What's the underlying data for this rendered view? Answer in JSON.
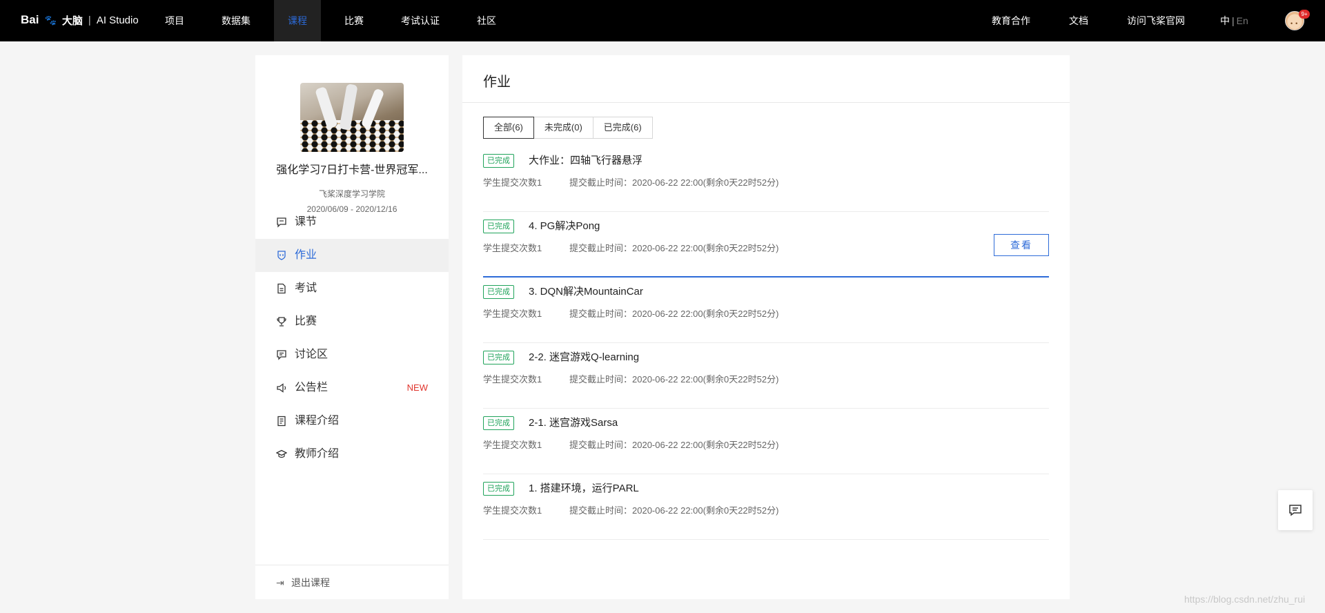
{
  "header": {
    "logo_text": "Bai",
    "logo_cn": "大脑",
    "logo_sep": "|",
    "logo_product": "AI Studio",
    "nav": [
      {
        "label": "项目"
      },
      {
        "label": "数据集"
      },
      {
        "label": "课程",
        "active": true
      },
      {
        "label": "比赛"
      },
      {
        "label": "考试认证"
      },
      {
        "label": "社区"
      }
    ],
    "right_links": [
      {
        "label": "教育合作"
      },
      {
        "label": "文档"
      },
      {
        "label": "访问飞桨官网"
      }
    ],
    "lang_zh": "中",
    "lang_sep": "|",
    "lang_en": "En",
    "notification_badge": "9+"
  },
  "sidebar": {
    "course_title": "强化学习7日打卡营-世界冠军...",
    "course_org": "飞桨深度学习学院",
    "course_date": "2020/06/09 - 2020/12/16",
    "menu": [
      {
        "label": "课节",
        "icon": "chat-square-icon"
      },
      {
        "label": "作业",
        "icon": "shield-icon",
        "active": true
      },
      {
        "label": "考试",
        "icon": "document-icon"
      },
      {
        "label": "比赛",
        "icon": "trophy-icon"
      },
      {
        "label": "讨论区",
        "icon": "comment-icon"
      },
      {
        "label": "公告栏",
        "icon": "speaker-icon",
        "badge": "NEW"
      },
      {
        "label": "课程介绍",
        "icon": "notebook-icon"
      },
      {
        "label": "教师介绍",
        "icon": "graduation-cap-icon"
      }
    ],
    "exit_label": "退出课程"
  },
  "main": {
    "title": "作业",
    "tabs": [
      {
        "label": "全部(6)",
        "active": true
      },
      {
        "label": "未完成(0)"
      },
      {
        "label": "已完成(6)"
      }
    ],
    "homework": [
      {
        "status": "已完成",
        "name": "大作业：四轴飞行器悬浮",
        "submits": "学生提交次数1",
        "deadline": "提交截止时间：2020-06-22 22:00(剩余0天22时52分)"
      },
      {
        "status": "已完成",
        "name": "4. PG解决Pong",
        "submits": "学生提交次数1",
        "deadline": "提交截止时间：2020-06-22 22:00(剩余0天22时52分)",
        "highlighted": true,
        "action": "查看"
      },
      {
        "status": "已完成",
        "name": "3. DQN解决MountainCar",
        "submits": "学生提交次数1",
        "deadline": "提交截止时间：2020-06-22 22:00(剩余0天22时52分)"
      },
      {
        "status": "已完成",
        "name": "2-2. 迷宫游戏Q-learning",
        "submits": "学生提交次数1",
        "deadline": "提交截止时间：2020-06-22 22:00(剩余0天22时52分)"
      },
      {
        "status": "已完成",
        "name": "2-1. 迷宫游戏Sarsa",
        "submits": "学生提交次数1",
        "deadline": "提交截止时间：2020-06-22 22:00(剩余0天22时52分)"
      },
      {
        "status": "已完成",
        "name": "1. 搭建环境，运行PARL",
        "submits": "学生提交次数1",
        "deadline": "提交截止时间：2020-06-22 22:00(剩余0天22时52分)"
      }
    ]
  },
  "watermark": "https://blog.csdn.net/zhu_rui",
  "colors": {
    "accent": "#2c6ad8",
    "status_green": "#1fa35a",
    "new_red": "#e0342c",
    "topbar": "#000000"
  }
}
